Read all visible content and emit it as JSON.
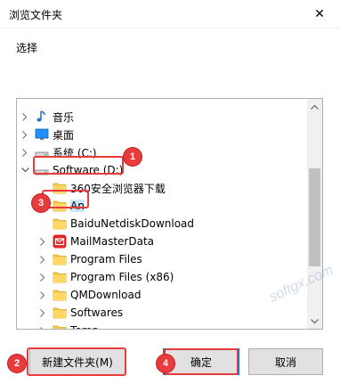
{
  "window": {
    "title": "浏览文件夹",
    "close": "✕"
  },
  "prompt": "选择",
  "tree": {
    "items": [
      {
        "label": "音乐",
        "icon": "music-icon",
        "expander": ">"
      },
      {
        "label": "桌面",
        "icon": "desktop-icon",
        "expander": ">"
      },
      {
        "label": "系统 (C:)",
        "icon": "drive-icon",
        "expander": ">"
      },
      {
        "label": "Software (D:)",
        "icon": "drive-icon",
        "expander": "v"
      },
      {
        "label": "360安全浏览器下载",
        "icon": "folder-icon",
        "expander": ""
      },
      {
        "label": "An",
        "icon": "folder-icon",
        "expander": "",
        "selected": true
      },
      {
        "label": "BaiduNetdiskDownload",
        "icon": "folder-icon",
        "expander": ""
      },
      {
        "label": "MailMasterData",
        "icon": "mailmaster-icon",
        "expander": ">"
      },
      {
        "label": "Program Files",
        "icon": "folder-icon",
        "expander": ">"
      },
      {
        "label": "Program Files (x86)",
        "icon": "folder-icon",
        "expander": ">"
      },
      {
        "label": "QMDownload",
        "icon": "folder-icon",
        "expander": ">"
      },
      {
        "label": "Softwares",
        "icon": "folder-icon",
        "expander": ">"
      },
      {
        "label": "Temp",
        "icon": "folder-icon",
        "expander": ">"
      }
    ]
  },
  "buttons": {
    "new_folder": "新建文件夹(M)",
    "ok": "确定",
    "cancel": "取消"
  },
  "annotations": [
    "1",
    "2",
    "3",
    "4"
  ],
  "watermark": "softgx.com",
  "colors": {
    "accent": "#0078d7",
    "annotation": "#e83b3b",
    "folder": "#f5c84c"
  }
}
